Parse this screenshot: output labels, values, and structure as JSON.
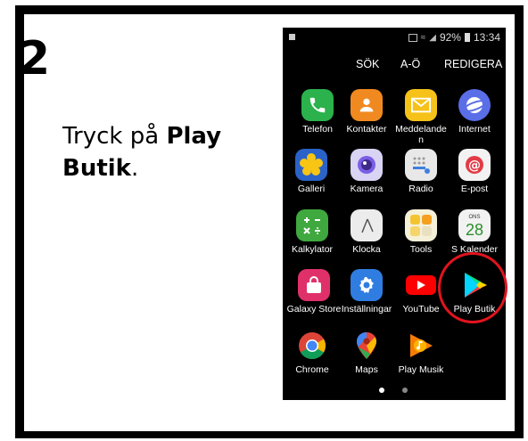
{
  "step": {
    "number": "2"
  },
  "instruction": {
    "prefix": "Tryck på ",
    "bold": "Play Butik",
    "suffix": "."
  },
  "status_bar": {
    "battery": "92%",
    "time": "13:34"
  },
  "top_menu": {
    "search": "SÖK",
    "az": "A-Ö",
    "edit": "REDIGERA"
  },
  "apps": [
    {
      "label": "Telefon",
      "icon": "phone-icon",
      "color": "#2bb24c"
    },
    {
      "label": "Kontakter",
      "icon": "contacts-icon",
      "color": "#f08a20"
    },
    {
      "label": "Meddelanden",
      "icon": "messages-icon",
      "color": "#f6c21a"
    },
    {
      "label": "Internet",
      "icon": "internet-icon",
      "color": "#5a6ee8"
    },
    {
      "label": "Galleri",
      "icon": "gallery-icon",
      "color": "#f8c514"
    },
    {
      "label": "Kamera",
      "icon": "camera-icon",
      "color": "#7b5ee6"
    },
    {
      "label": "Radio",
      "icon": "radio-icon",
      "color": "#e8e8e8"
    },
    {
      "label": "E-post",
      "icon": "email-icon",
      "color": "#e23b46"
    },
    {
      "label": "Kalkylator",
      "icon": "calculator-icon",
      "color": "#3fa83f"
    },
    {
      "label": "Klocka",
      "icon": "clock-icon",
      "color": "#ececec"
    },
    {
      "label": "Tools",
      "icon": "tools-icon",
      "color": "#f5f0d8"
    },
    {
      "label": "S Kalender",
      "icon": "calendar-icon",
      "color": "#f2f2f2"
    },
    {
      "label": "Galaxy Store",
      "icon": "galaxy-store-icon",
      "color": "#e0306a"
    },
    {
      "label": "Inställningar",
      "icon": "settings-icon",
      "color": "#2f7de1"
    },
    {
      "label": "YouTube",
      "icon": "youtube-icon",
      "color": "#000000"
    },
    {
      "label": "Play Butik",
      "icon": "play-store-icon",
      "color": "#000000"
    },
    {
      "label": "Chrome",
      "icon": "chrome-icon",
      "color": "#ffffff"
    },
    {
      "label": "Maps",
      "icon": "maps-icon",
      "color": "#000000"
    },
    {
      "label": "Play Musik",
      "icon": "play-music-icon",
      "color": "#f57c00"
    }
  ],
  "calendar": {
    "day": "ONS",
    "date": "28"
  },
  "highlight_color": "#e0141e"
}
